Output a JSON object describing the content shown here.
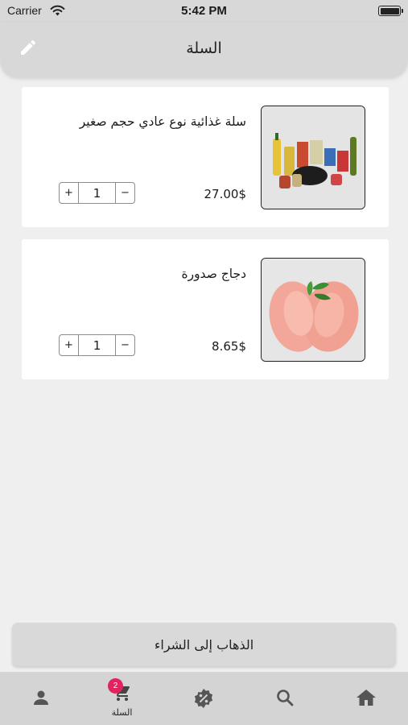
{
  "status_bar": {
    "carrier": "Carrier",
    "time": "5:42 PM"
  },
  "header": {
    "title": "السلة",
    "edit_icon": "pencil-icon"
  },
  "cart_items": [
    {
      "name": "سلة غذائية نوع عادي حجم صغير",
      "price": "27.00$",
      "quantity": "1",
      "plus": "+",
      "minus": "−",
      "image": "food-basket-image"
    },
    {
      "name": "دجاج صدورة",
      "price": "8.65$",
      "quantity": "1",
      "plus": "+",
      "minus": "−",
      "image": "chicken-breast-image"
    }
  ],
  "checkout": {
    "label": "الذهاب إلى الشراء"
  },
  "tab_bar": {
    "tabs": [
      {
        "icon": "profile-icon",
        "label": ""
      },
      {
        "icon": "cart-icon",
        "label": "السلة",
        "badge": "2"
      },
      {
        "icon": "discount-icon",
        "label": ""
      },
      {
        "icon": "search-icon",
        "label": ""
      },
      {
        "icon": "home-icon",
        "label": ""
      }
    ],
    "badge_color": "#e0245e"
  }
}
